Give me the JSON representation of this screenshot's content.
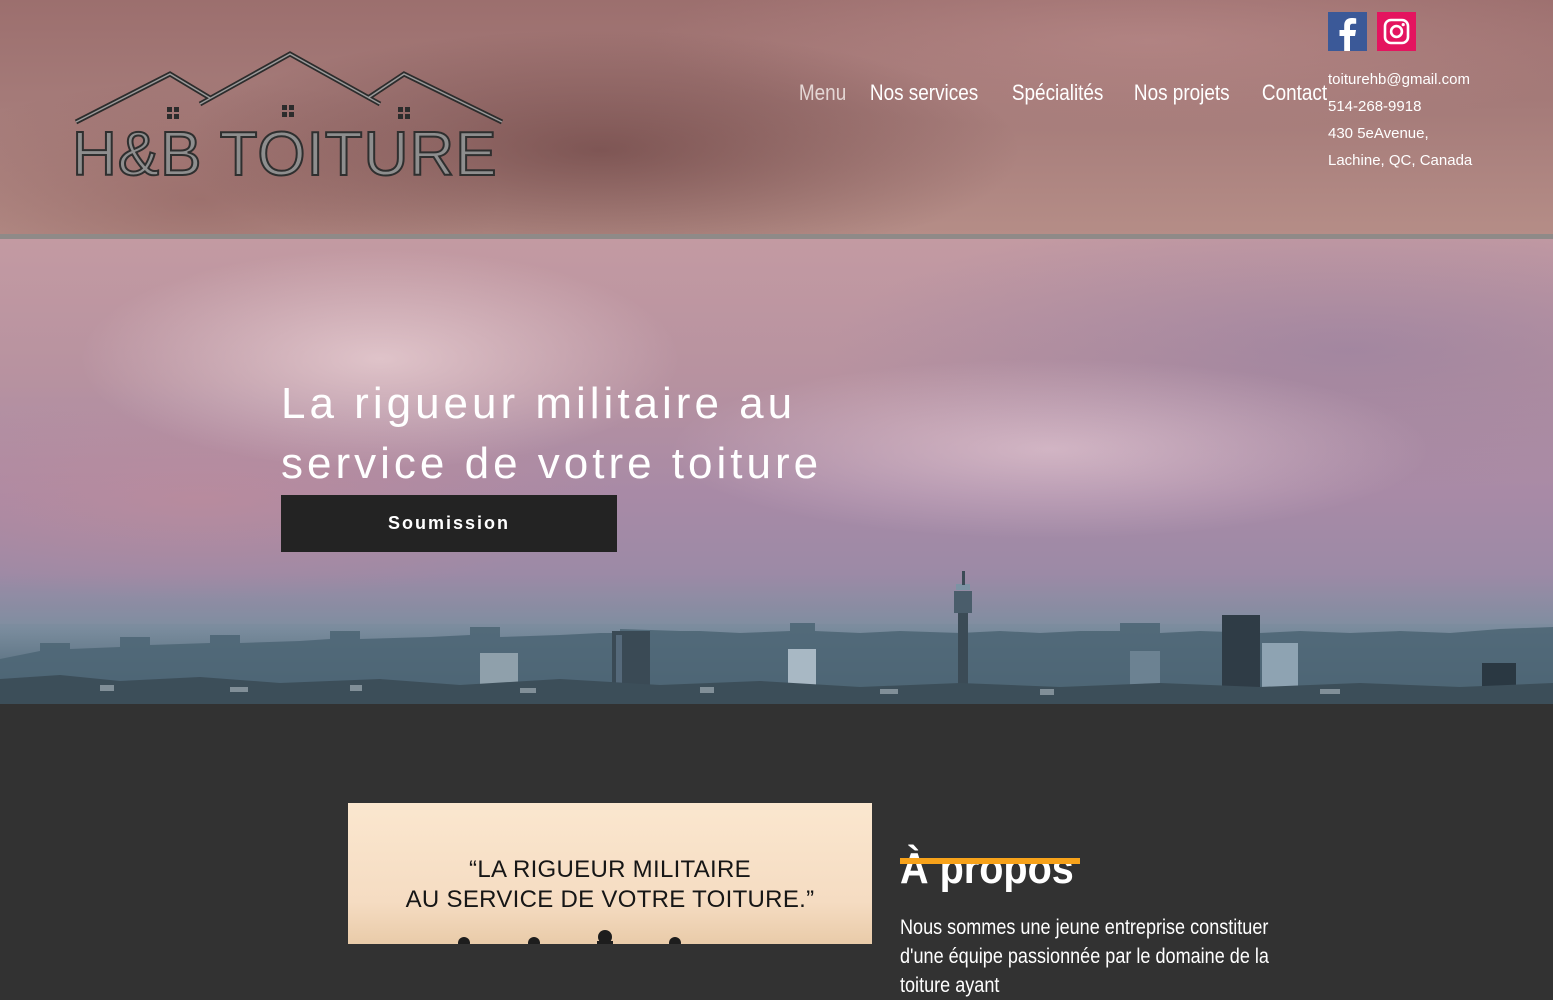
{
  "header": {
    "logo_text": "H&B TOITURE",
    "nav": [
      {
        "label": "Menu"
      },
      {
        "label": "Nos services"
      },
      {
        "label": "Spécialités"
      },
      {
        "label": "Nos projets"
      },
      {
        "label": "Contact"
      }
    ],
    "social": [
      {
        "name": "facebook-icon",
        "color": "#3b5998"
      },
      {
        "name": "instagram-icon",
        "color": "#e4145f"
      }
    ],
    "contact": {
      "email": "toiturehb@gmail.com",
      "phone": "514-268-9918",
      "address_line1": "430 5eAvenue,",
      "address_line2": "Lachine, QC, Canada"
    }
  },
  "hero": {
    "title_line1": "La rigueur militaire au",
    "title_line2": "service de votre toiture",
    "cta_label": "Soumission"
  },
  "about": {
    "quote_line1": "“LA RIGUEUR MILITAIRE",
    "quote_line2": "AU SERVICE DE VOTRE TOITURE.”",
    "title": "À propos",
    "body": "Nous sommes une jeune entreprise constituer d'une équipe passionnée par le domaine de la toiture ayant",
    "accent_color": "#f7a21a"
  }
}
